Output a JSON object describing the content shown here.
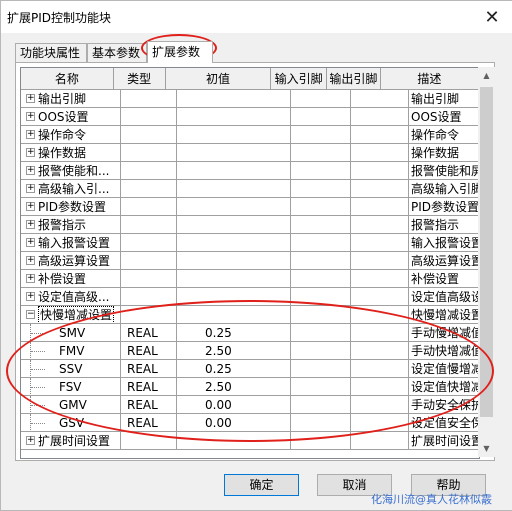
{
  "window": {
    "title": "扩展PID控制功能块",
    "close_glyph": "✕"
  },
  "tabs": [
    {
      "label": "功能块属性",
      "active": false
    },
    {
      "label": "基本参数",
      "active": false
    },
    {
      "label": "扩展参数",
      "active": true
    }
  ],
  "grid": {
    "columns": [
      "名称",
      "类型",
      "初值",
      "输入引脚",
      "输出引脚",
      "描述"
    ],
    "groups": [
      {
        "label": "输出引脚",
        "desc": "输出引脚"
      },
      {
        "label": "OOS设置",
        "desc": "OOS设置"
      },
      {
        "label": "操作命令",
        "desc": "操作命令"
      },
      {
        "label": "操作数据",
        "desc": "操作数据"
      },
      {
        "label": "报警使能和...",
        "desc": "报警使能和屏蔽"
      },
      {
        "label": "高级输入引...",
        "desc": "高级输入引脚设置"
      },
      {
        "label": "PID参数设置",
        "desc": "PID参数设置"
      },
      {
        "label": "报警指示",
        "desc": "报警指示"
      },
      {
        "label": "输入报警设置",
        "desc": "输入报警设置"
      },
      {
        "label": "高级运算设置",
        "desc": "高级运算设置"
      },
      {
        "label": "补偿设置",
        "desc": "补偿设置"
      },
      {
        "label": "设定值高级...",
        "desc": "设定值高级设置"
      },
      {
        "label": "快慢增减设置",
        "desc": "快慢增减设置",
        "expanded": true
      }
    ],
    "children": [
      {
        "name": "SMV",
        "type": "REAL",
        "init": "0.25",
        "desc": "手动慢增减值"
      },
      {
        "name": "FMV",
        "type": "REAL",
        "init": "2.50",
        "desc": "手动快增减值"
      },
      {
        "name": "SSV",
        "type": "REAL",
        "init": "0.25",
        "desc": "设定值慢增减值"
      },
      {
        "name": "FSV",
        "type": "REAL",
        "init": "2.50",
        "desc": "设定值快增减值"
      },
      {
        "name": "GMV",
        "type": "REAL",
        "init": "0.00",
        "desc": "手动安全保护输入..."
      },
      {
        "name": "GSV",
        "type": "REAL",
        "init": "0.00",
        "desc": "设定值安全保护输..."
      }
    ],
    "trailing_group": {
      "label": "扩展时间设置",
      "desc": "扩展时间设置"
    },
    "expander_plus": "+",
    "expander_minus": "−"
  },
  "buttons": {
    "ok": "确定",
    "cancel": "取消",
    "help": "帮助"
  },
  "watermark": "化海川流@真人花林似霰",
  "annotation_color": "#e0201a"
}
